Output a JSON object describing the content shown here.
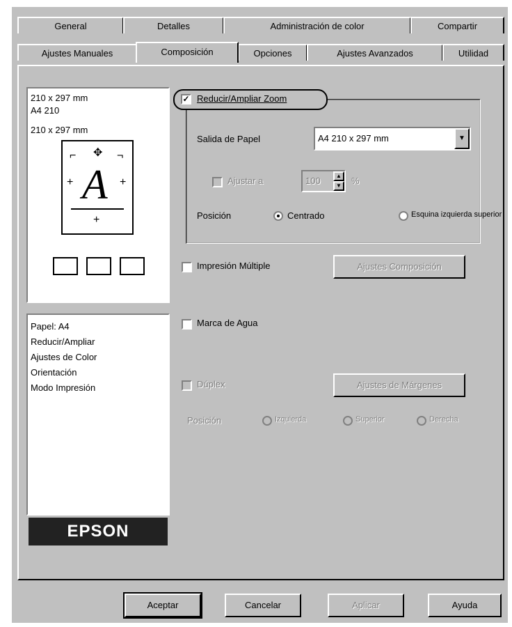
{
  "tabs_row_top": [
    "General",
    "Detalles",
    "Administración de color",
    "Compartir"
  ],
  "tabs_row_bottom": [
    "Ajustes Manuales",
    "Composición",
    "Opciones",
    "Ajustes Avanzados",
    "Utilidad"
  ],
  "preview": {
    "lines": [
      "210 x 297 mm",
      "A4 210",
      "210 x 297 mm"
    ],
    "letter": "A"
  },
  "zoom": {
    "checkbox_label": "Reducir/Ampliar Zoom",
    "checked": true,
    "output_paper_label": "Salida de Papel",
    "output_paper_value": "A4 210 x 297 mm",
    "scale_label": "Ajustar a",
    "scale_value": "100",
    "scale_unit": "%",
    "position_label": "Posición",
    "position_options": [
      "Centrado",
      "Esquina izquierda superior"
    ],
    "position_selected": "Centrado"
  },
  "multiple_pages": {
    "label": "Impresión Múltiple",
    "button": "Ajustes Composición"
  },
  "watermark": {
    "label": "Marca de Agua"
  },
  "duplex": {
    "label": "Dúplex",
    "button": "Ajustes de Márgenes",
    "binding_label": "Posición",
    "binding_options": [
      "Izquierda",
      "Superior",
      "Derecha"
    ]
  },
  "summary": {
    "items": [
      "Papel: A4",
      "Reducir/Ampliar",
      "Ajustes de Color",
      "Orientación",
      "Modo Impresión"
    ]
  },
  "brand": "EPSON",
  "buttons": {
    "ok": "Aceptar",
    "cancel": "Cancelar",
    "apply": "Aplicar",
    "help": "Ayuda"
  }
}
